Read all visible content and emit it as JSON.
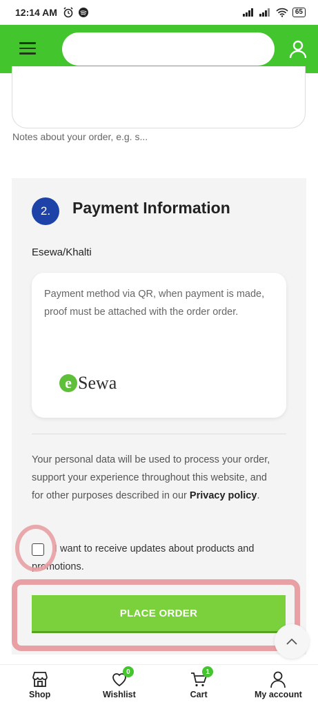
{
  "status_bar": {
    "time": "12:14 AM",
    "battery": "65"
  },
  "header": {
    "search_placeholder": ""
  },
  "notes": {
    "hint": "Notes about your order, e.g. s..."
  },
  "payment": {
    "step_number": "2.",
    "title": "Payment Information",
    "method_label": "Esewa/Khalti",
    "method_description": "Payment method via QR, when payment is made, proof must be attached with the order order.",
    "logo_letter": "e",
    "logo_text": "Sewa",
    "privacy_text_before": "Your personal data will be used to process your order, support your experience throughout this website, and for other purposes described in our ",
    "privacy_link": "Privacy policy",
    "privacy_text_after": ".",
    "updates_label": "I want to receive updates about products and promotions.",
    "place_order_label": "PLACE ORDER"
  },
  "bottom_nav": {
    "items": [
      {
        "label": "Shop",
        "icon": "store-icon"
      },
      {
        "label": "Wishlist",
        "icon": "heart-icon",
        "badge": "0"
      },
      {
        "label": "Cart",
        "icon": "cart-icon",
        "badge": "1"
      },
      {
        "label": "My account",
        "icon": "user-icon"
      }
    ]
  },
  "colors": {
    "header_green": "#43c52e",
    "button_green": "#7ad13b",
    "step_blue": "#1d43a8",
    "highlight_pink": "#e8a0a4"
  }
}
